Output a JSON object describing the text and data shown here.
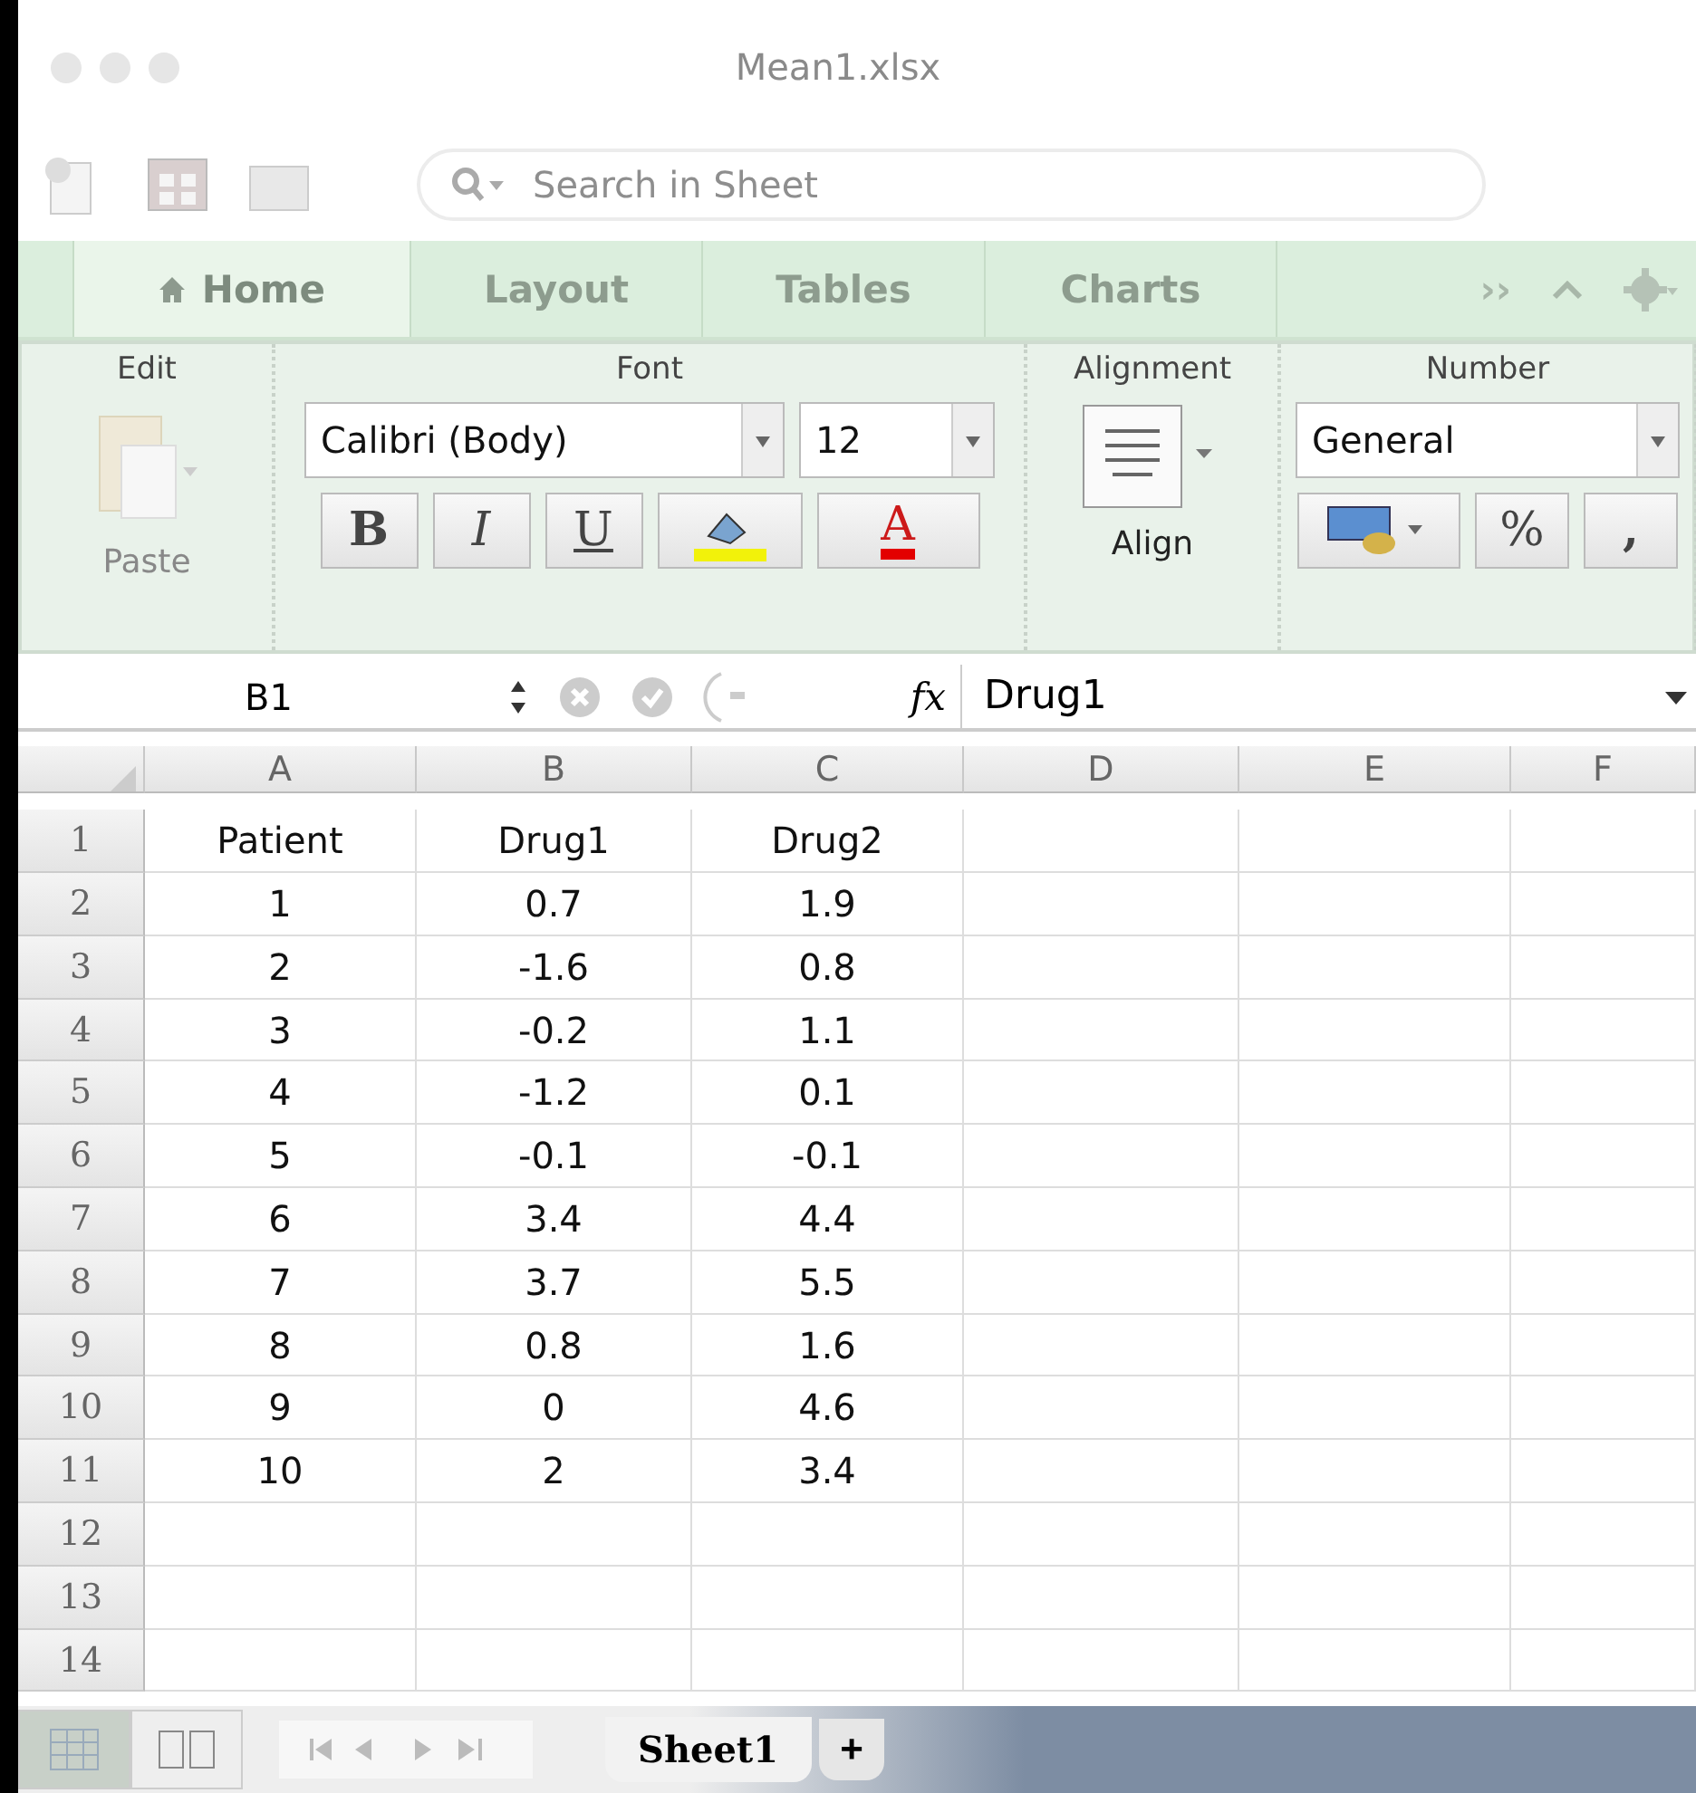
{
  "window": {
    "title": "Mean1.xlsx"
  },
  "toolbar": {
    "search": {
      "placeholder": "Search in Sheet"
    }
  },
  "tabs": [
    {
      "label": "Home",
      "selected": true
    },
    {
      "label": "Layout",
      "selected": false
    },
    {
      "label": "Tables",
      "selected": false
    },
    {
      "label": "Charts",
      "selected": false
    }
  ],
  "overflow_tab": "››",
  "ribbon": {
    "groups": [
      "Edit",
      "Font",
      "Alignment",
      "Number"
    ],
    "paste": "Paste",
    "font_name": "Calibri (Body)",
    "font_size": "12",
    "style_buttons": [
      "B",
      "I",
      "U"
    ],
    "font_color_letter": "A",
    "align": "Align",
    "number_format": "General",
    "percent": "%",
    "comma": ","
  },
  "formula_bar": {
    "name_box": "B1",
    "fx": "fx",
    "value": "Drug1"
  },
  "columns": [
    "A",
    "B",
    "C",
    "D",
    "E",
    "F"
  ],
  "rows": [
    {
      "number": "1",
      "cells": [
        "Patient",
        "Drug1",
        "Drug2"
      ]
    },
    {
      "number": "2",
      "cells": [
        "1",
        "0.7",
        "1.9"
      ]
    },
    {
      "number": "3",
      "cells": [
        "2",
        "-1.6",
        "0.8"
      ]
    },
    {
      "number": "4",
      "cells": [
        "3",
        "-0.2",
        "1.1"
      ]
    },
    {
      "number": "5",
      "cells": [
        "4",
        "-1.2",
        "0.1"
      ]
    },
    {
      "number": "6",
      "cells": [
        "5",
        "-0.1",
        "-0.1"
      ]
    },
    {
      "number": "7",
      "cells": [
        "6",
        "3.4",
        "4.4"
      ]
    },
    {
      "number": "8",
      "cells": [
        "7",
        "3.7",
        "5.5"
      ]
    },
    {
      "number": "9",
      "cells": [
        "8",
        "0.8",
        "1.6"
      ]
    },
    {
      "number": "10",
      "cells": [
        "9",
        "0",
        "4.6"
      ]
    },
    {
      "number": "11",
      "cells": [
        "10",
        "2",
        "3.4"
      ]
    },
    {
      "number": "12"
    },
    {
      "number": "13"
    },
    {
      "number": "14"
    }
  ],
  "sheet_tabs": [
    {
      "label": "Sheet1",
      "selected": true
    }
  ],
  "add_sheet": "+"
}
